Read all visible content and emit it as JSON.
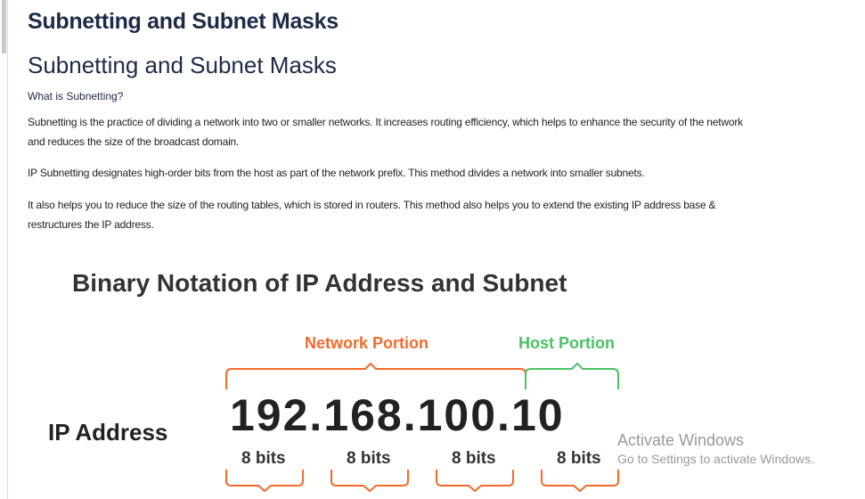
{
  "page": {
    "title_bold": "Subnetting and Subnet Masks",
    "title": "Subnetting and Subnet Masks",
    "question": "What is Subnetting?",
    "paragraphs": [
      "Subnetting is the practice of dividing a network into two or smaller networks. It increases routing efficiency, which helps to enhance the security of the network and reduces the size of the broadcast domain.",
      "IP Subnetting designates high-order bits from the host as part of the network prefix. This method divides a network into smaller subnets.",
      "It also helps you to reduce the size of the routing tables, which is stored in routers. This method also helps you to extend the existing IP address base & restructures the IP address."
    ]
  },
  "figure": {
    "title": "Binary Notation of IP Address and Subnet",
    "network_label": "Network Portion",
    "host_label": "Host Portion",
    "ip_label": "IP Address",
    "ip_value": "192.168.100.10",
    "bits": [
      "8 bits",
      "8 bits",
      "8 bits",
      "8 bits"
    ],
    "colors": {
      "network": "#f26b2b",
      "host": "#4cc163"
    }
  },
  "watermark": {
    "line1": "Activate Windows",
    "line2": "Go to Settings to activate Windows."
  }
}
